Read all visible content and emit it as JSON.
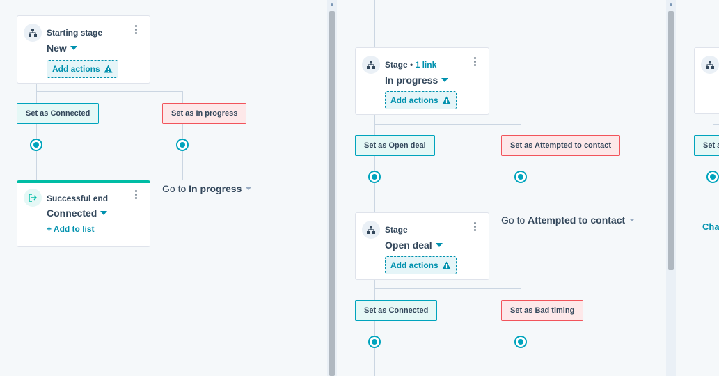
{
  "columns": [
    {
      "card": {
        "subtitle": "Starting stage",
        "stage": "New",
        "action_label": "Add actions"
      },
      "branches": [
        {
          "label": "Set as Connected",
          "kind": "success"
        },
        {
          "label": "Set as In progress",
          "kind": "danger"
        }
      ],
      "end_card": {
        "subtitle": "Successful end",
        "stage": "Connected",
        "link_label": "+ Add to list"
      },
      "goto": {
        "prefix": "Go to",
        "target": "In progress"
      }
    },
    {
      "card": {
        "subtitle": "Stage",
        "link_count": "1 link",
        "stage": "In progress",
        "action_label": "Add actions"
      },
      "branches": [
        {
          "label": "Set as Open deal",
          "kind": "success"
        },
        {
          "label": "Set as Attempted to contact",
          "kind": "danger"
        }
      ],
      "goto": {
        "prefix": "Go to",
        "target": "Attempted to contact"
      },
      "card2": {
        "subtitle": "Stage",
        "stage": "Open deal",
        "action_label": "Add actions"
      },
      "branches2": [
        {
          "label": "Set as Connected",
          "kind": "success"
        },
        {
          "label": "Set as Bad timing",
          "kind": "danger"
        }
      ]
    },
    {
      "branch_partial": "Set a",
      "goto_partial": "Cha"
    }
  ],
  "colors": {
    "accent": "#0091ae",
    "success_fill": "#e5f8f6",
    "success_border": "#00a4bd",
    "danger_fill": "#fde8e9",
    "danger_border": "#f2545b"
  },
  "icons": [
    "stage-icon",
    "more-options-icon",
    "warning-icon",
    "caret-down-icon",
    "exit-icon",
    "branch-connector-icon",
    "scroll-up-icon"
  ]
}
